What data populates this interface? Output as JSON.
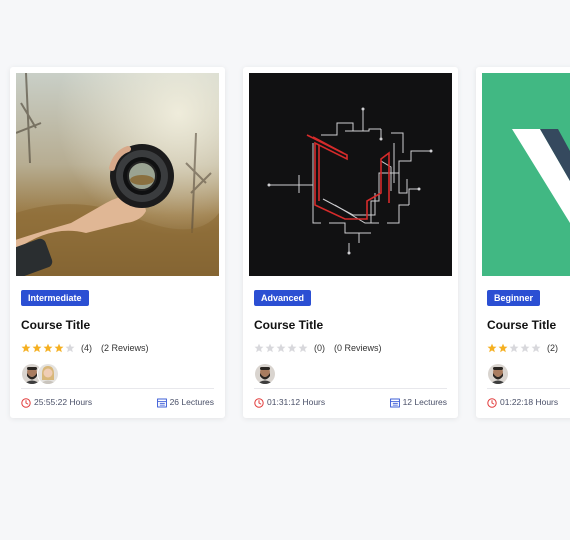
{
  "colors": {
    "badge": "#2b4fd3",
    "star_filled": "#f5b022",
    "star_empty": "#d8d8dc",
    "clock_icon": "#e23a3a",
    "lectures_icon": "#2b4fd3"
  },
  "courses": [
    {
      "level": "Intermediate",
      "title": "Course Title",
      "rating_stars": 4,
      "rating_count": "(4)",
      "reviews": "(2 Reviews)",
      "instructors": [
        "avatar-bearded-man",
        "avatar-blonde-woman"
      ],
      "duration": "25:55:22 Hours",
      "lectures": "26 Lectures"
    },
    {
      "level": "Advanced",
      "title": "Course Title",
      "rating_stars": 0,
      "rating_count": "(0)",
      "reviews": "(0 Reviews)",
      "instructors": [
        "avatar-bearded-man"
      ],
      "duration": "01:31:12 Hours",
      "lectures": "12 Lectures"
    },
    {
      "level": "Beginner",
      "title": "Course Title",
      "rating_stars": 2,
      "rating_count": "(2)",
      "reviews": "",
      "instructors": [
        "avatar-bearded-man"
      ],
      "duration": "01:22:18 Hours",
      "lectures": ""
    }
  ]
}
